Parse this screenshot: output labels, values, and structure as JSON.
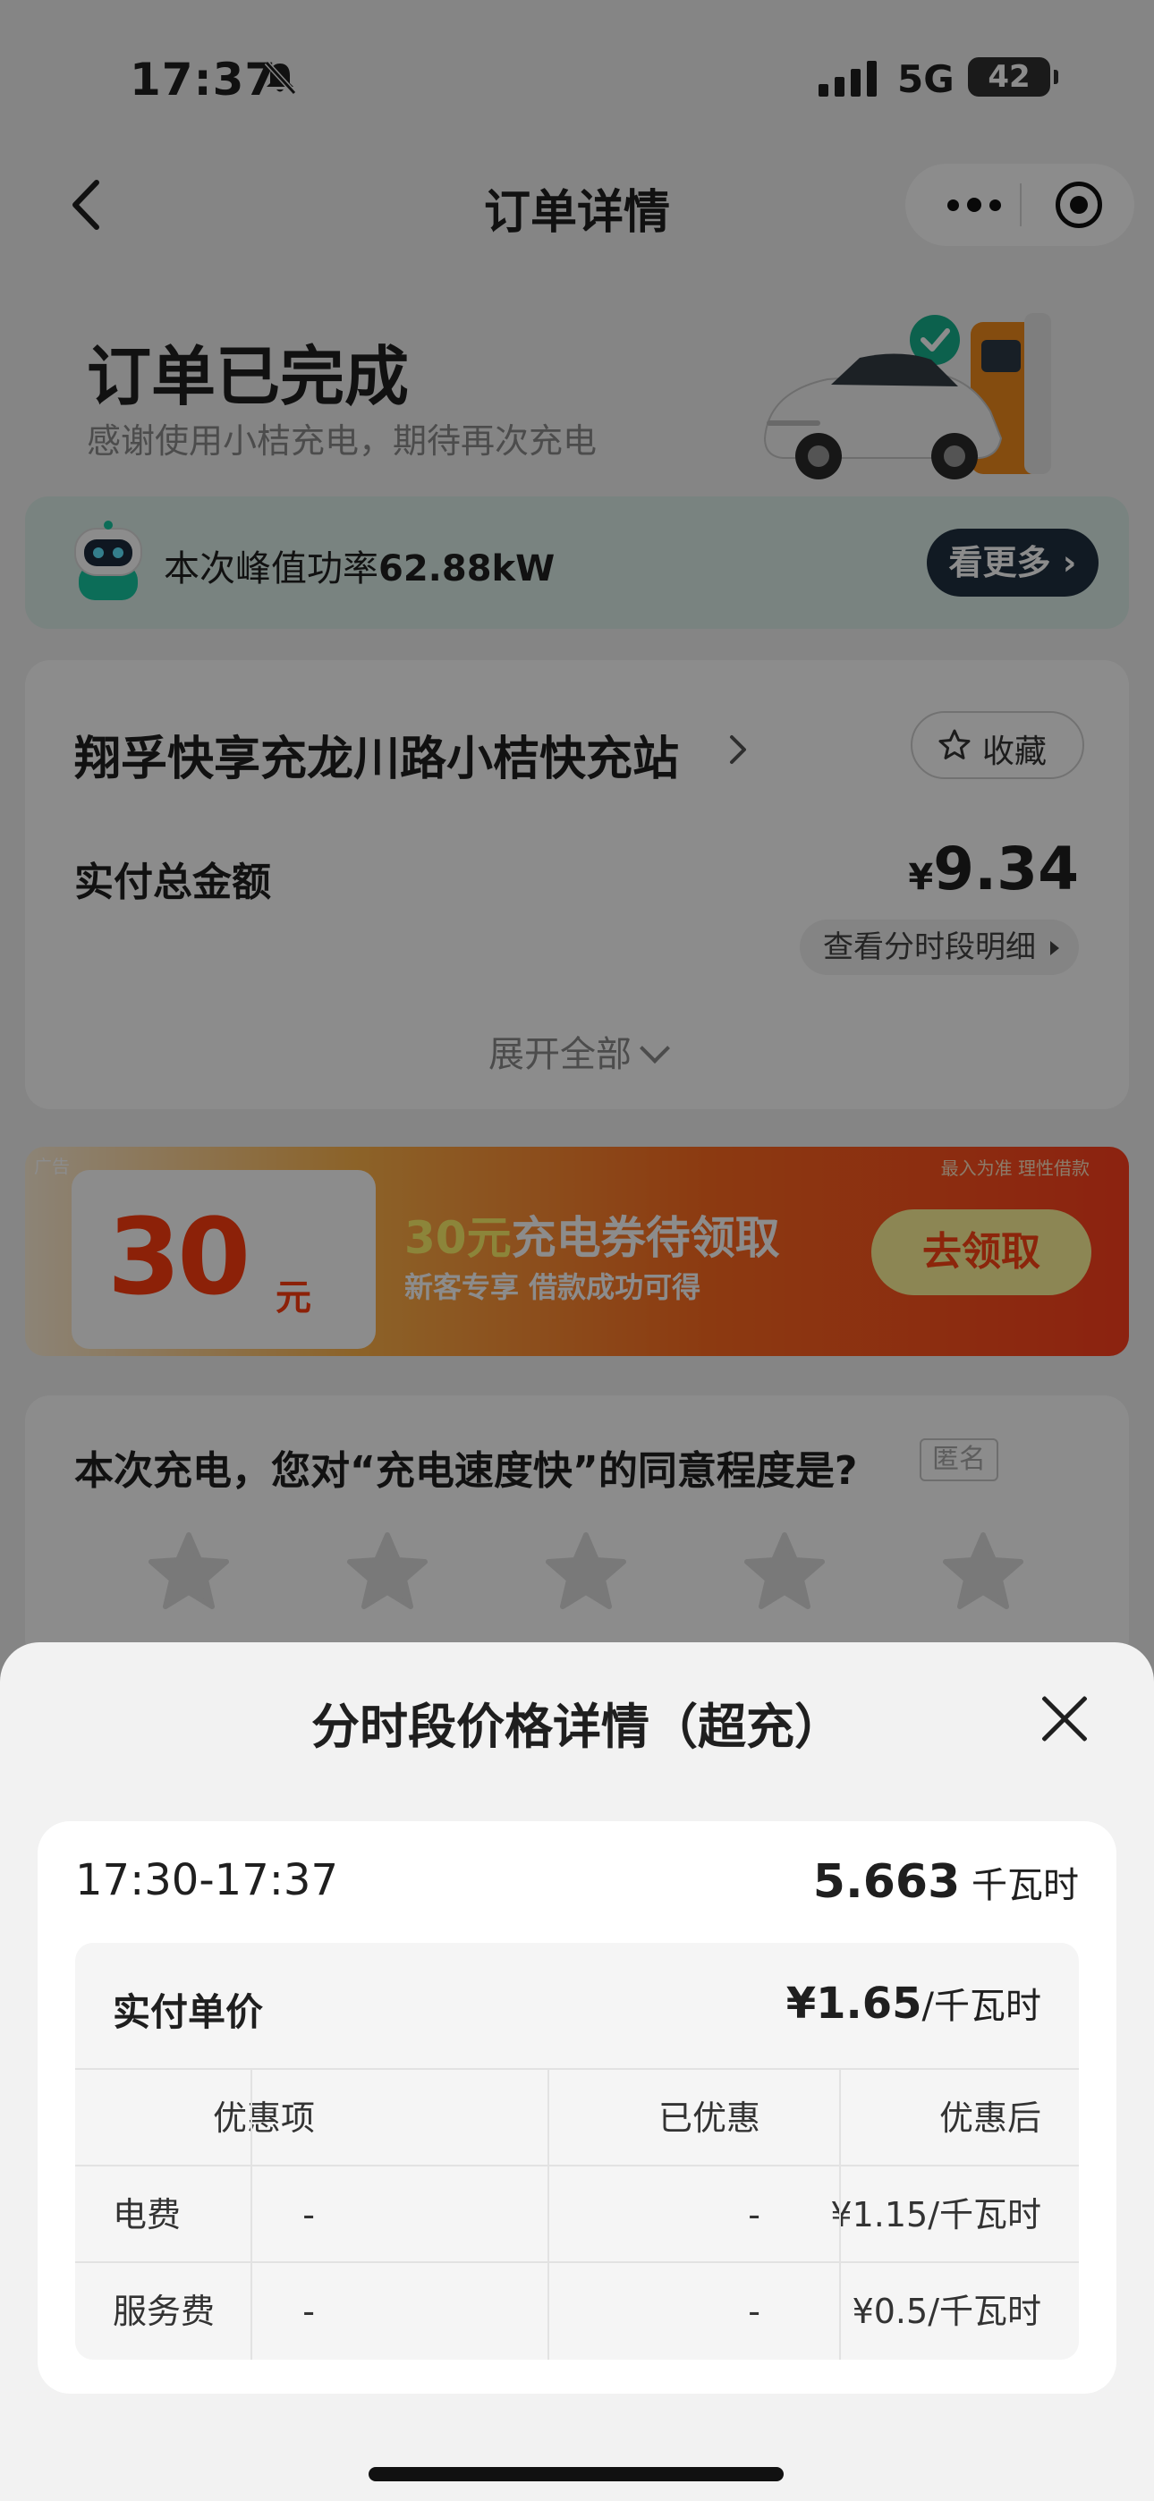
{
  "status_bar": {
    "time": "17:37",
    "network": "5G",
    "battery": "42"
  },
  "nav": {
    "title": "订单详情"
  },
  "header": {
    "title": "订单已完成",
    "subtitle": "感谢使用小桔充电，期待再次充电"
  },
  "power_banner": {
    "label": "本次峰值功率",
    "value": "62.88kW",
    "button": "看更多"
  },
  "order_card": {
    "station_name": "翔孚快享充龙川路小桔快充站",
    "favorite_button": "收藏",
    "total_label": "实付总金额",
    "currency": "¥",
    "total_amount": "9.34",
    "detail_link": "查看分时段明细",
    "expand": "展开全部"
  },
  "ad": {
    "tag": "广告",
    "disclaimer": "最入为准 理性借款",
    "coupon_amount": "30",
    "coupon_unit": "元",
    "title_highlight": "30元",
    "title_rest": "充电券待领取",
    "subtitle": "新客专享 借款成功可得",
    "button": "去领取"
  },
  "survey": {
    "question": "本次充电，您对“充电速度快”的同意程度是?",
    "anonymous": "匿名",
    "rating": 0,
    "max_rating": 5
  },
  "sheet": {
    "title": "分时段价格详情（超充）",
    "slot": {
      "time": "17:30-17:37",
      "energy": "5.663",
      "energy_unit": "千瓦时",
      "unit_price_label": "实付单价",
      "unit_price": "¥1.65",
      "unit_price_suffix": "/千瓦时",
      "columns": [
        "",
        "优惠项",
        "已优惠",
        "优惠后"
      ],
      "rows": [
        [
          "电费",
          "-",
          "-",
          "¥1.15/千瓦时"
        ],
        [
          "服务费",
          "-",
          "-",
          "¥0.5/千瓦时"
        ]
      ]
    }
  },
  "colors": {
    "primary_dark": "#203040",
    "ad_orange": "#ff6a1f",
    "coupon_red": "#ff3c10",
    "ad_highlight": "#fff36a",
    "power_banner_bg": "#dcefea"
  }
}
